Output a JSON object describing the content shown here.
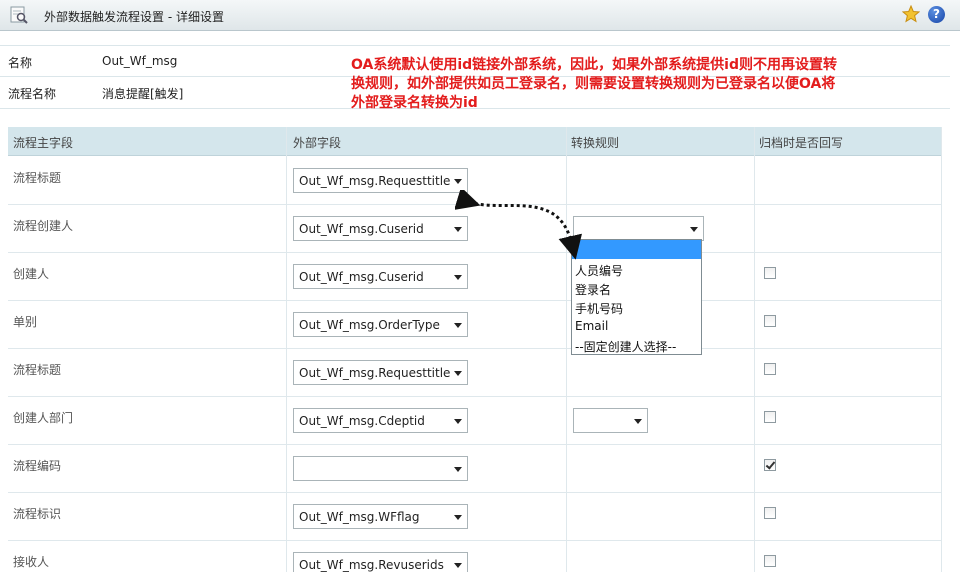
{
  "window": {
    "title": "外部数据触发流程设置 - 详细设置"
  },
  "info": [
    {
      "label": "名称",
      "value": "Out_Wf_msg"
    },
    {
      "label": "流程名称",
      "value": "消息提醒[触发]"
    }
  ],
  "note": "OA系统默认使用id链接外部系统，因此，如果外部系统提供id则不用再设置转换规则，如外部提供如员工登录名，则需要设置转换规则为已登录名以便OA将外部登录名转换为id",
  "table": {
    "headers": [
      "流程主字段",
      "外部字段",
      "转换规则",
      "归档时是否回写"
    ],
    "rows": [
      {
        "field": "流程标题",
        "external": "Out_Wf_msg.Requesttitle",
        "rule": null,
        "writeback": null
      },
      {
        "field": "流程创建人",
        "external": "Out_Wf_msg.Cuserid",
        "rule": "",
        "writeback": null
      },
      {
        "field": "创建人",
        "external": "Out_Wf_msg.Cuserid",
        "rule": null,
        "writeback": false
      },
      {
        "field": "单别",
        "external": "Out_Wf_msg.OrderType",
        "rule": null,
        "writeback": false
      },
      {
        "field": "流程标题",
        "external": "Out_Wf_msg.Requesttitle",
        "rule": null,
        "writeback": false
      },
      {
        "field": "创建人部门",
        "external": "Out_Wf_msg.Cdeptid",
        "rule": "",
        "writeback": false
      },
      {
        "field": "流程编码",
        "external": "",
        "rule": null,
        "writeback": true
      },
      {
        "field": "流程标识",
        "external": "Out_Wf_msg.WFflag",
        "rule": null,
        "writeback": false
      },
      {
        "field": "接收人",
        "external": "Out_Wf_msg.Revuserids",
        "rule": null,
        "writeback": false
      }
    ]
  },
  "dropdown": {
    "options": [
      "",
      "人员编号",
      "登录名",
      "手机号码",
      "Email",
      "--固定创建人选择--"
    ],
    "highlighted_index": 0
  },
  "colors": {
    "note": "#e31c1c",
    "header_bg": "#d4e6ec",
    "highlight": "#3399ff"
  }
}
